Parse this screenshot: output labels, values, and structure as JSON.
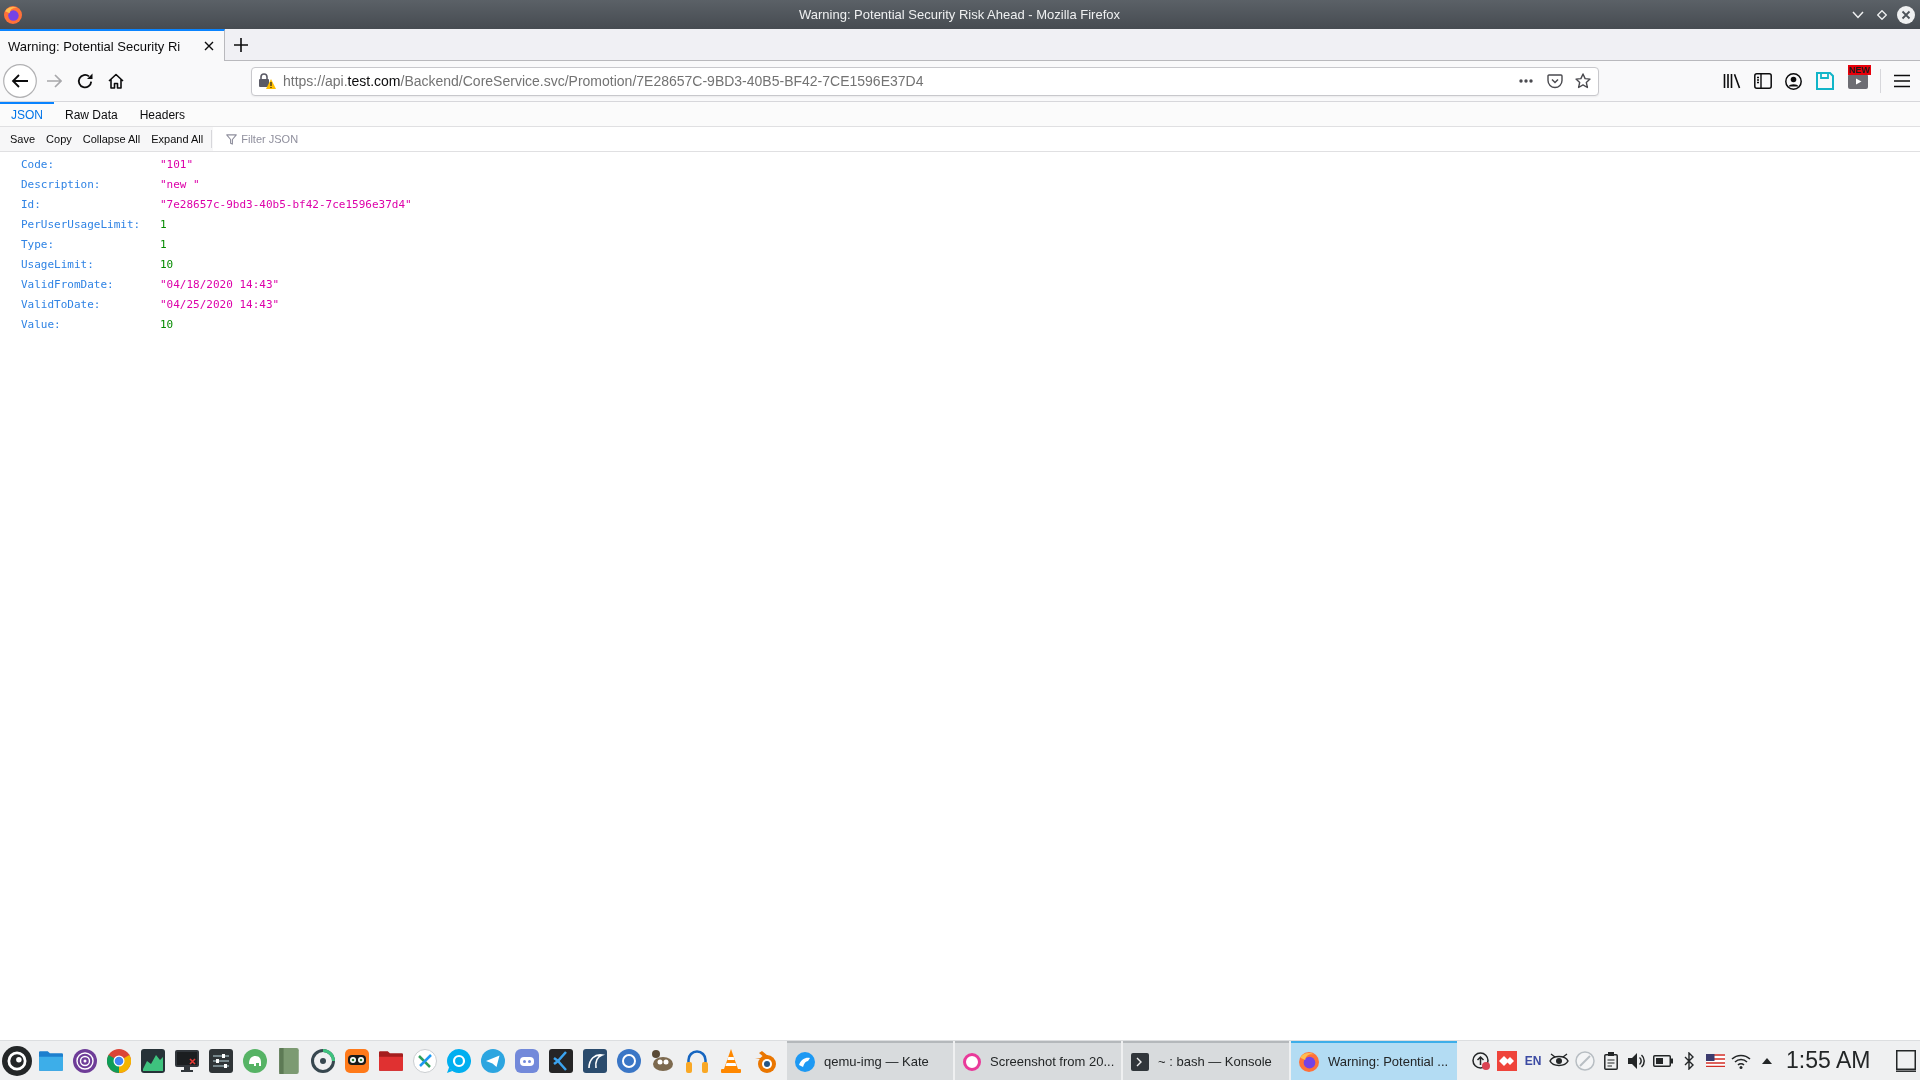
{
  "window": {
    "title": "Warning: Potential Security Risk Ahead - Mozilla Firefox"
  },
  "browser_tabs": [
    {
      "title": "Warning: Potential Security Ri",
      "selected": true
    }
  ],
  "navigation": {
    "forward_disabled": true
  },
  "address_bar": {
    "url": {
      "before_domain": "https://api.",
      "domain": "test.com",
      "after_domain": "/Backend/CoreService.svc/Promotion/7E28657C-9BD3-40B5-BF42-7CE1596E37D4"
    }
  },
  "toolbar": {
    "extension_badge": "NEW"
  },
  "viewer_tabs": [
    {
      "label": "JSON",
      "selected": true
    },
    {
      "label": "Raw Data",
      "selected": false
    },
    {
      "label": "Headers",
      "selected": false
    }
  ],
  "viewer_toolbar": {
    "buttons": [
      "Save",
      "Copy",
      "Collapse All",
      "Expand All"
    ],
    "filter": {
      "placeholder": "Filter JSON"
    }
  },
  "json_rows": [
    {
      "key": "Code:",
      "value": "\"101\"",
      "kind": "string"
    },
    {
      "key": "Description:",
      "value": "\"new \"",
      "kind": "string"
    },
    {
      "key": "Id:",
      "value": "\"7e28657c-9bd3-40b5-bf42-7ce1596e37d4\"",
      "kind": "string"
    },
    {
      "key": "PerUserUsageLimit:",
      "value": "1",
      "kind": "number"
    },
    {
      "key": "Type:",
      "value": "1",
      "kind": "number"
    },
    {
      "key": "UsageLimit:",
      "value": "10",
      "kind": "number"
    },
    {
      "key": "ValidFromDate:",
      "value": "\"04/18/2020 14:43\"",
      "kind": "string"
    },
    {
      "key": "ValidToDate:",
      "value": "\"04/25/2020 14:43\"",
      "kind": "string"
    },
    {
      "key": "Value:",
      "value": "10",
      "kind": "number"
    }
  ],
  "taskbar": {
    "tasks": [
      {
        "label": "qemu-img — Kate",
        "kind": "editor",
        "selected": false
      },
      {
        "label": "Screenshot from 20...",
        "kind": "viewer",
        "selected": false
      },
      {
        "label": "~ : bash — Konsole",
        "kind": "terminal",
        "selected": false
      },
      {
        "label": "Warning: Potential ...",
        "kind": "browser",
        "selected": true
      }
    ],
    "keyboard_layout": "EN",
    "clock": "1:55 AM"
  }
}
